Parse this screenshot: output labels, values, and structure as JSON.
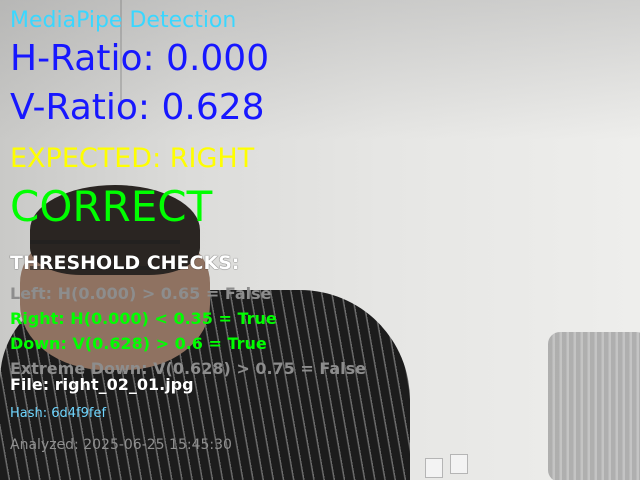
{
  "overlay": {
    "title": "MediaPipe Detection",
    "h_ratio": "H-Ratio: 0.000",
    "v_ratio": "V-Ratio: 0.628",
    "expected": "EXPECTED: RIGHT",
    "result": "CORRECT",
    "checks_heading": "THRESHOLD CHECKS:",
    "checks": [
      {
        "text": "Left: H(0.000) > 0.65 = False",
        "passed": false
      },
      {
        "text": "Right: H(0.000) < 0.35 = True",
        "passed": true
      },
      {
        "text": "Down: V(0.628) > 0.6 = True",
        "passed": true
      },
      {
        "text": "Extreme Down: V(0.628) > 0.75 = False",
        "passed": false
      }
    ],
    "file": "File: right_02_01.jpg",
    "hash": "Hash: 6d4f9fef",
    "analyzed": "Analyzed: 2025-06-25 15:45:30"
  },
  "colors": {
    "title": "#3ad7ff",
    "ratio": "#1717ff",
    "expected": "#ffff00",
    "correct": "#00ff00",
    "check_pass": "#00ff00",
    "check_fail": "#8d8d8d",
    "file": "#ffffff",
    "hash": "#6fd6ff",
    "analyzed": "#8f8f8f"
  }
}
